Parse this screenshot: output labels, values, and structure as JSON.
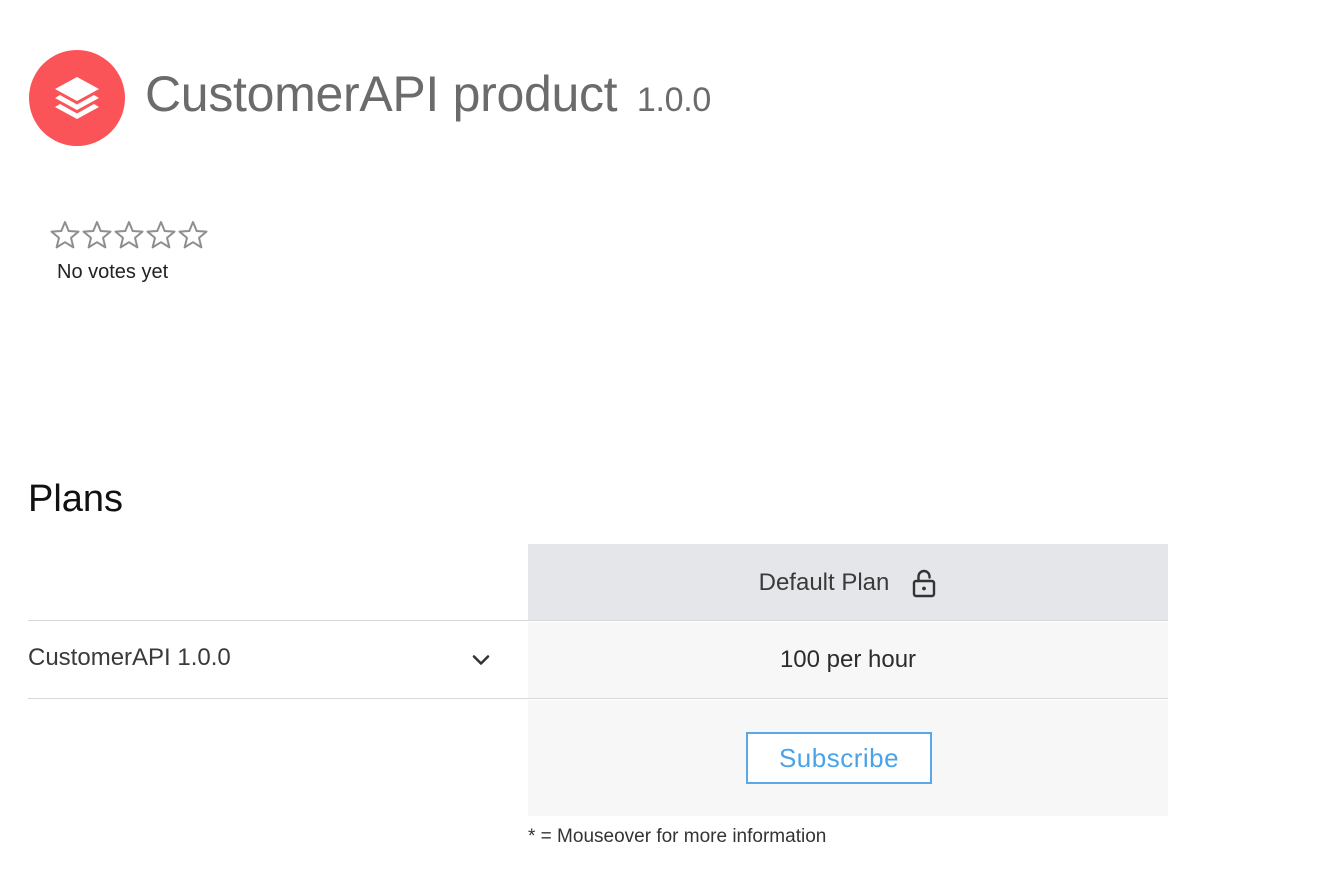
{
  "product": {
    "title": "CustomerAPI product",
    "version": "1.0.0",
    "logo_icon": "stacked-layers-icon",
    "brand_color": "#fa5458"
  },
  "rating": {
    "stars_filled": 0,
    "stars_total": 5,
    "text": "No votes yet"
  },
  "plans": {
    "heading": "Plans",
    "columns": [
      {
        "name": "Default Plan",
        "icon": "unlocked-padlock-icon"
      }
    ],
    "rows": [
      {
        "api_label": "CustomerAPI 1.0.0",
        "expand_icon": "chevron-down-icon",
        "rate_limit": "100 per hour"
      }
    ],
    "subscribe_label": "Subscribe",
    "footnote": "* = Mouseover for more information"
  },
  "colors": {
    "header_cell_bg": "#e4e6ea",
    "cell_bg": "#f7f7f7",
    "button_border": "#5aa8e8",
    "button_text": "#4aa3e8"
  }
}
